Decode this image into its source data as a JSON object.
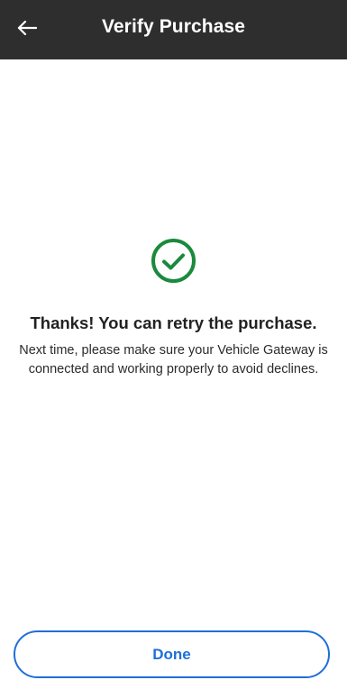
{
  "header": {
    "title": "Verify Purchase",
    "back_icon": "arrow-left-icon",
    "background_color": "#2e2e2e"
  },
  "status": {
    "icon": "check-circle-icon",
    "icon_color": "#1a8a3c"
  },
  "message": {
    "title": "Thanks! You can retry the purchase.",
    "body": "Next time, please make sure your Vehicle Gateway is connected and working properly to avoid declines."
  },
  "actions": {
    "done_label": "Done",
    "accent_color": "#1f6fd8"
  }
}
